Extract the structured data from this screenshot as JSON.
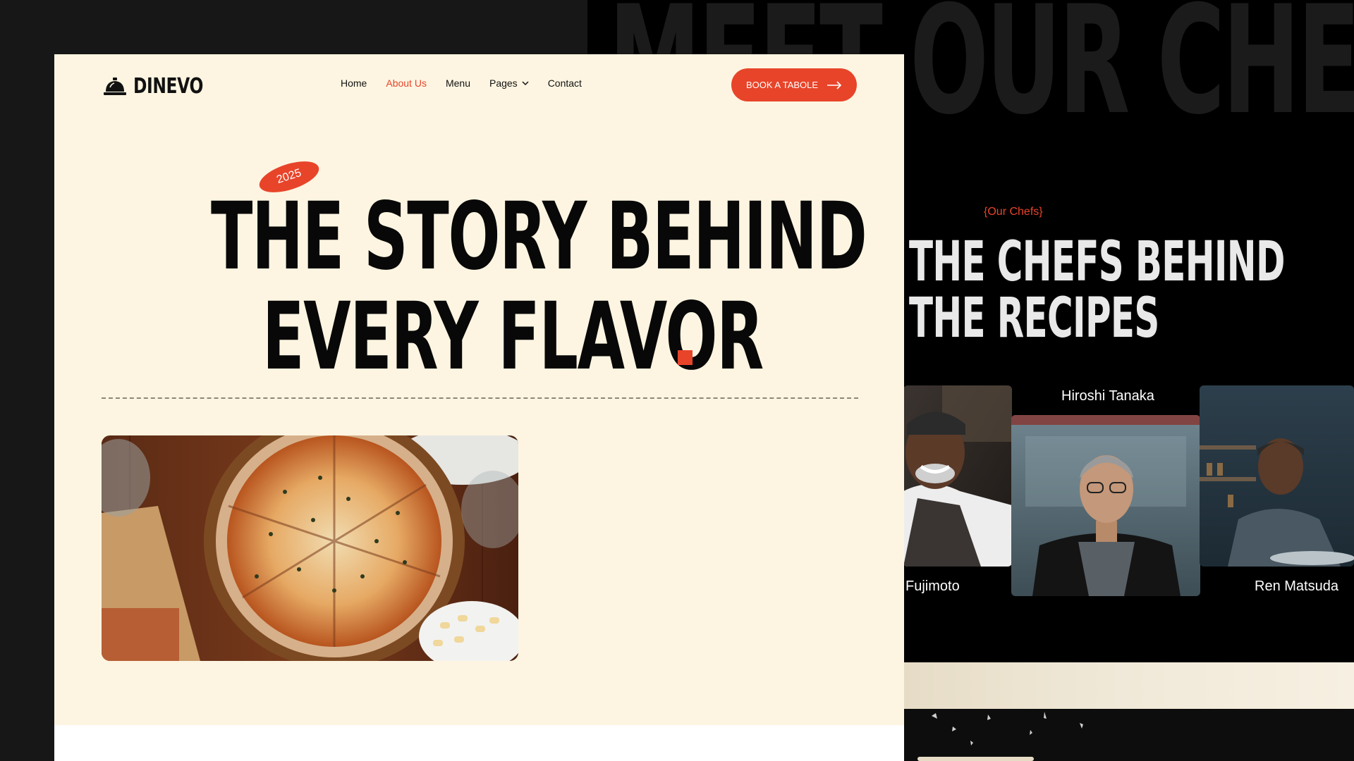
{
  "brand": {
    "name": "DINEVO",
    "logo_icon": "service-bell-icon"
  },
  "nav": {
    "items": [
      {
        "label": "Home",
        "active": false
      },
      {
        "label": "About Us",
        "active": true
      },
      {
        "label": "Menu",
        "active": false
      },
      {
        "label": "Pages",
        "active": false,
        "has_dropdown": true
      },
      {
        "label": "Contact",
        "active": false
      }
    ]
  },
  "cta": {
    "label": "BOOK A TABOLE",
    "icon": "arrow-right-icon"
  },
  "hero": {
    "badge": "2025",
    "line1": "THE STORY BEHIND",
    "line2": "EVERY FLAVOR",
    "image_alt": "pizza-on-wooden-table"
  },
  "chefs_section": {
    "background_title": "MEET OUR CHEF",
    "kicker": "{Our Chefs}",
    "title_line1": "THE CHEFS BEHIND",
    "title_line2": "THE RECIPES",
    "chefs": [
      {
        "name": "Fujimoto"
      },
      {
        "name": "Hiroshi Tanaka"
      },
      {
        "name": "Ren Matsuda"
      }
    ]
  },
  "colors": {
    "accent": "#e8442a",
    "cream": "#fdf5e1",
    "dark": "#000000",
    "text": "#080808"
  }
}
